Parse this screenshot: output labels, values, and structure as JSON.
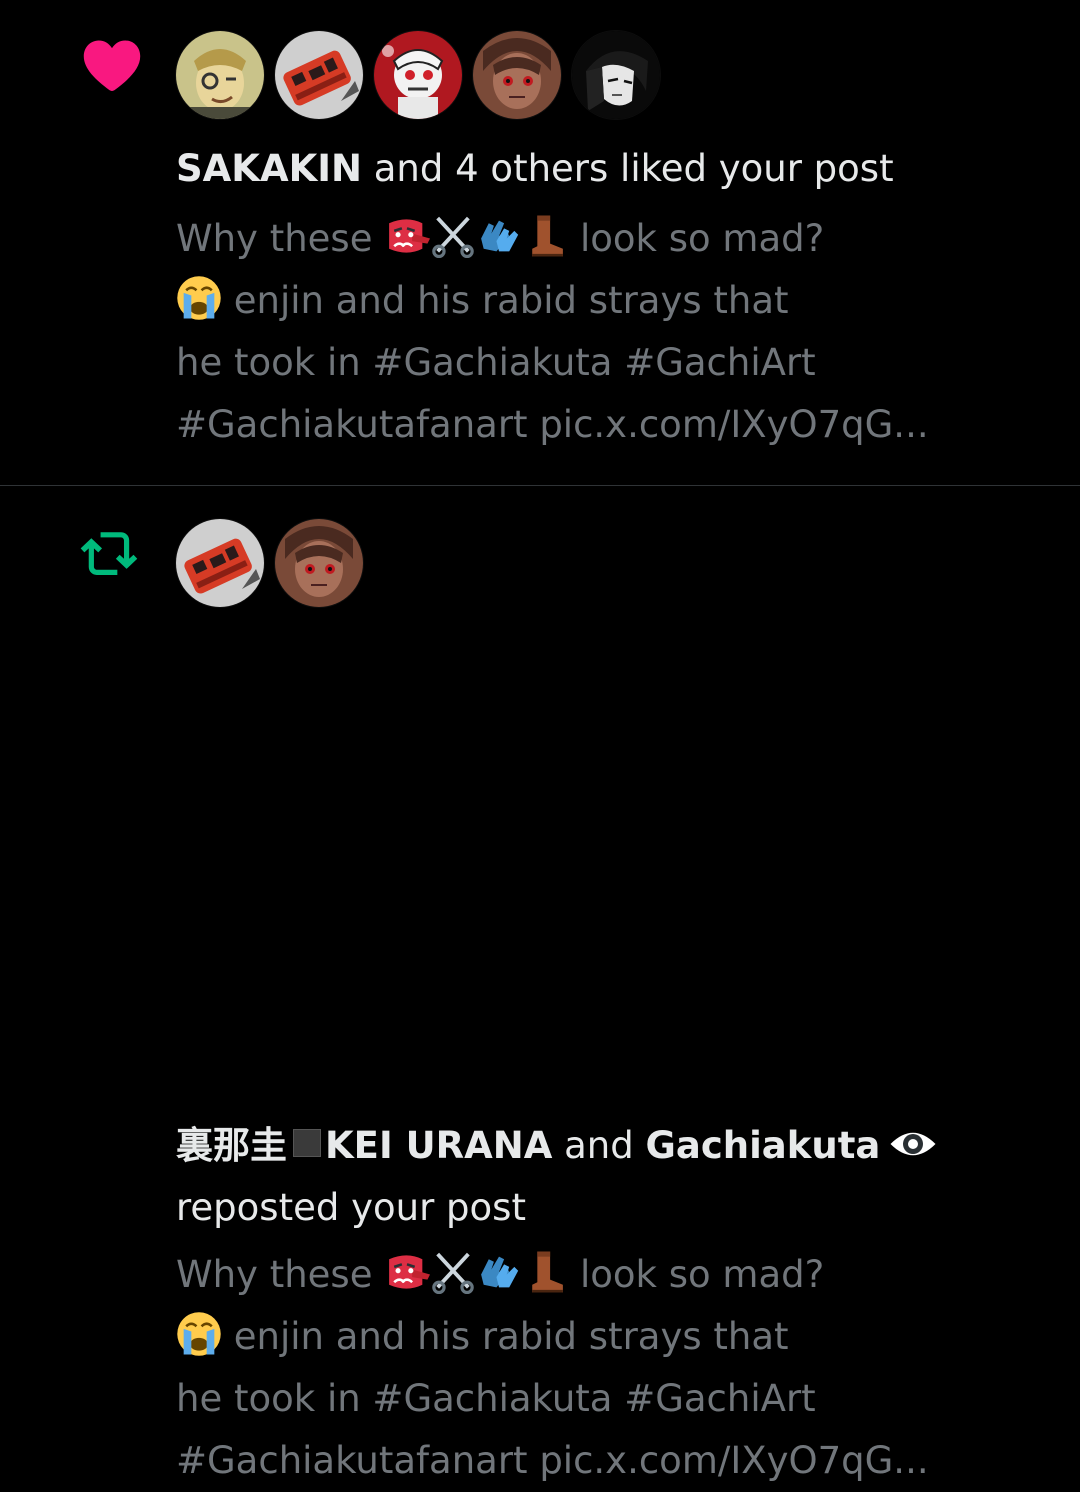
{
  "colors": {
    "like": "#f91880",
    "repost": "#00ba7c",
    "primary_text": "#e7e9ea",
    "secondary_text": "#71767b",
    "background": "#000000",
    "divider": "#2f3336"
  },
  "notifications": [
    {
      "type": "like",
      "type_icon": "heart-icon",
      "actor": "SAKAKIN",
      "action": " and 4 others liked your post",
      "post_preview": {
        "line1": "Why these",
        "line1_emojis": [
          "tengu-mask-emoji",
          "scissors-emoji",
          "gloves-emoji",
          "boot-emoji"
        ],
        "line1_end": "look so mad?",
        "line2_emoji": "crying-face-emoji",
        "line2": "enjin and his rabid strays that",
        "line3": "he took in #Gachiakuta #GachiArt",
        "line4": "#Gachiakutafanart pic.x.com/IXyO7qG..."
      }
    },
    {
      "type": "repost",
      "type_icon": "repost-icon",
      "actor1": "裏那圭",
      "actor1_badge": "black-square-icon",
      "actor1_suffix": "KEI URANA",
      "joiner": " and ",
      "actor2": "Gachiakuta",
      "actor2_badge": "eye-icon",
      "action": "reposted your post",
      "post_preview": {
        "line1": "Why these",
        "line1_emojis": [
          "tengu-mask-emoji",
          "scissors-emoji",
          "gloves-emoji",
          "boot-emoji"
        ],
        "line1_end": "look so mad?",
        "line2_emoji": "crying-face-emoji",
        "line2": "enjin and his rabid strays that",
        "line3": "he took in #Gachiakuta #GachiArt",
        "line4": "#Gachiakutafanart pic.x.com/IXyO7qG..."
      }
    }
  ]
}
